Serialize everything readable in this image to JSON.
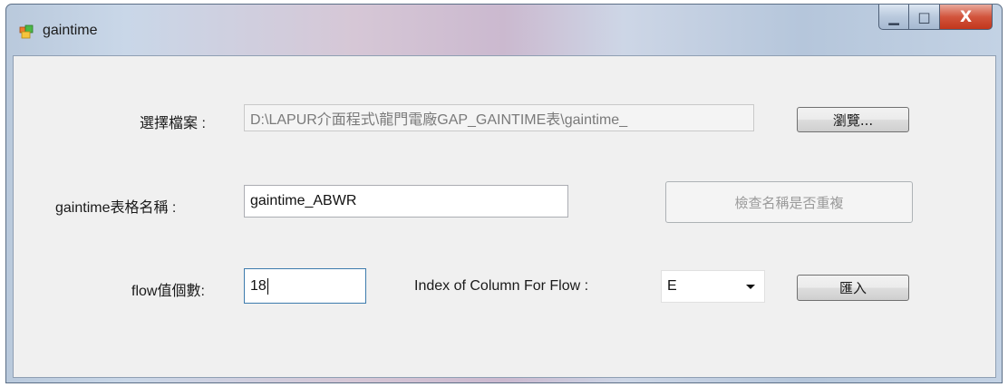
{
  "window": {
    "title": "gaintime",
    "title_icon": "app-window-icon",
    "controls": {
      "minimize_icon": "minimize-icon",
      "maximize_icon": "maximize-icon",
      "close_icon": "close-icon",
      "minimize_glyph": "▁",
      "maximize_glyph": "□",
      "close_glyph": "X"
    }
  },
  "form": {
    "file_label": "選擇檔案 :",
    "file_path": "D:\\LAPUR介面程式\\龍門電廠GAP_GAINTIME表\\gaintime_",
    "browse_button": "瀏覽...",
    "table_name_label": "gaintime表格名稱 :",
    "table_name_value": "gaintime_ABWR",
    "check_name_button": "檢查名稱是否重複",
    "flow_count_label": "flow值個數:",
    "flow_count_value": "18",
    "column_index_label": "Index of Column For Flow :",
    "column_index_value": "E",
    "import_button": "匯入"
  },
  "colors": {
    "client_background": "#f0f0f0",
    "close_button": "#c2361c",
    "focus_border": "#3d7bad"
  }
}
